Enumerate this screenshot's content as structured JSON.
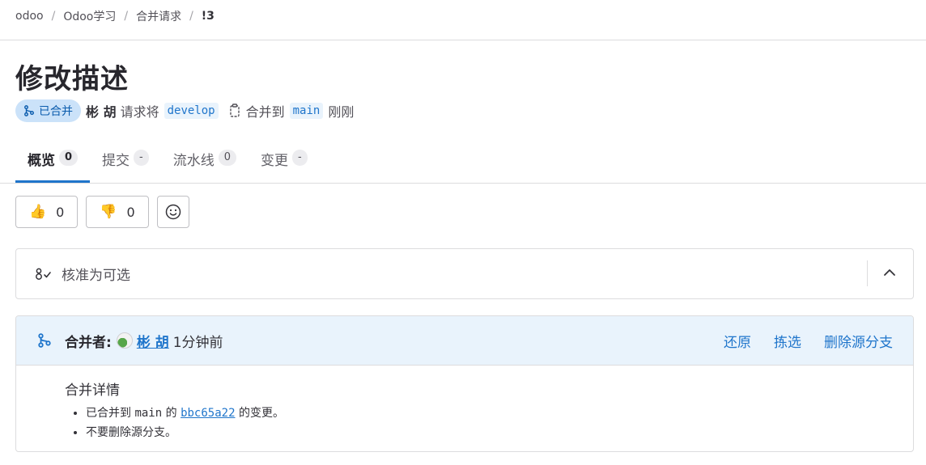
{
  "breadcrumb": {
    "items": [
      "odoo",
      "Odoo学习",
      "合并请求",
      "!3"
    ],
    "separator": "/"
  },
  "mr": {
    "title": "修改描述",
    "status_badge": "已合并",
    "author": "彬 胡",
    "request_text": "请求将",
    "source_branch": "develop",
    "merge_to_text": "合并到",
    "target_branch": "main",
    "time": "刚刚"
  },
  "tabs": [
    {
      "label": "概览",
      "count": "0"
    },
    {
      "label": "提交",
      "count": "-"
    },
    {
      "label": "流水线",
      "count": "0"
    },
    {
      "label": "变更",
      "count": "-"
    }
  ],
  "reactions": {
    "thumbs_up_count": "0",
    "thumbs_down_count": "0"
  },
  "approval": {
    "label": "核准为可选"
  },
  "merged": {
    "by_label": "合并者:",
    "user": "彬 胡",
    "time": "1分钟前",
    "actions": {
      "revert": "还原",
      "cherry_pick": "拣选",
      "delete_source": "删除源分支"
    },
    "details_title": "合并详情",
    "line1_prefix": "已合并到",
    "line1_branch": "main",
    "line1_of": "的",
    "line1_commit": "bbc65a22",
    "line1_suffix": "的变更。",
    "line2": "不要删除源分支。"
  },
  "colors": {
    "accent": "#1f75cb",
    "merged_bg": "#cbe2f9",
    "panel_bg": "#e9f3fc"
  }
}
